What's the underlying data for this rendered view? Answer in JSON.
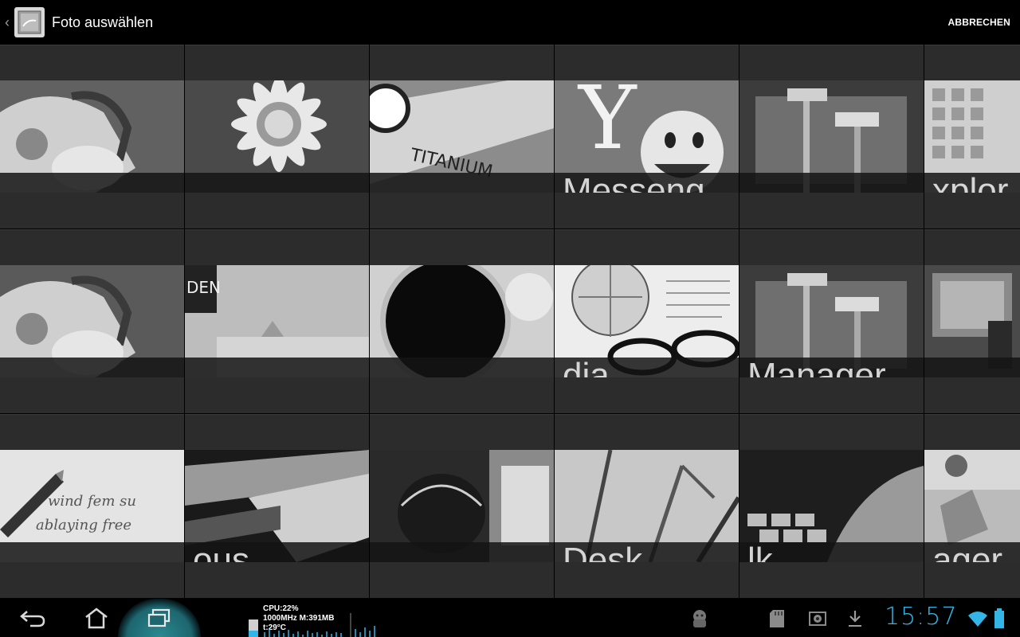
{
  "actionbar": {
    "title": "Foto auswählen",
    "cancel_label": "ABBRECHEN"
  },
  "tiles": [
    {
      "caption": ""
    },
    {
      "caption": ""
    },
    {
      "caption": ""
    },
    {
      "caption": "Messeng"
    },
    {
      "caption": ""
    },
    {
      "caption": "xplor"
    },
    {
      "caption": ""
    },
    {
      "caption": ""
    },
    {
      "caption": ""
    },
    {
      "caption": "dia"
    },
    {
      "caption": "Manager"
    },
    {
      "caption": ""
    },
    {
      "caption": ""
    },
    {
      "caption": "ous"
    },
    {
      "caption": ""
    },
    {
      "caption": "Desk"
    },
    {
      "caption": "lk"
    },
    {
      "caption": "ager"
    }
  ],
  "status": {
    "cpu": "CPU:22%",
    "freq_mem": "1000MHz M:391MB",
    "temp": "t:29°C",
    "clock": "15:57"
  },
  "colors": {
    "accent": "#33b5e5",
    "tile_bg": "#2c2c2c",
    "recents_glow": "#1d6670"
  }
}
